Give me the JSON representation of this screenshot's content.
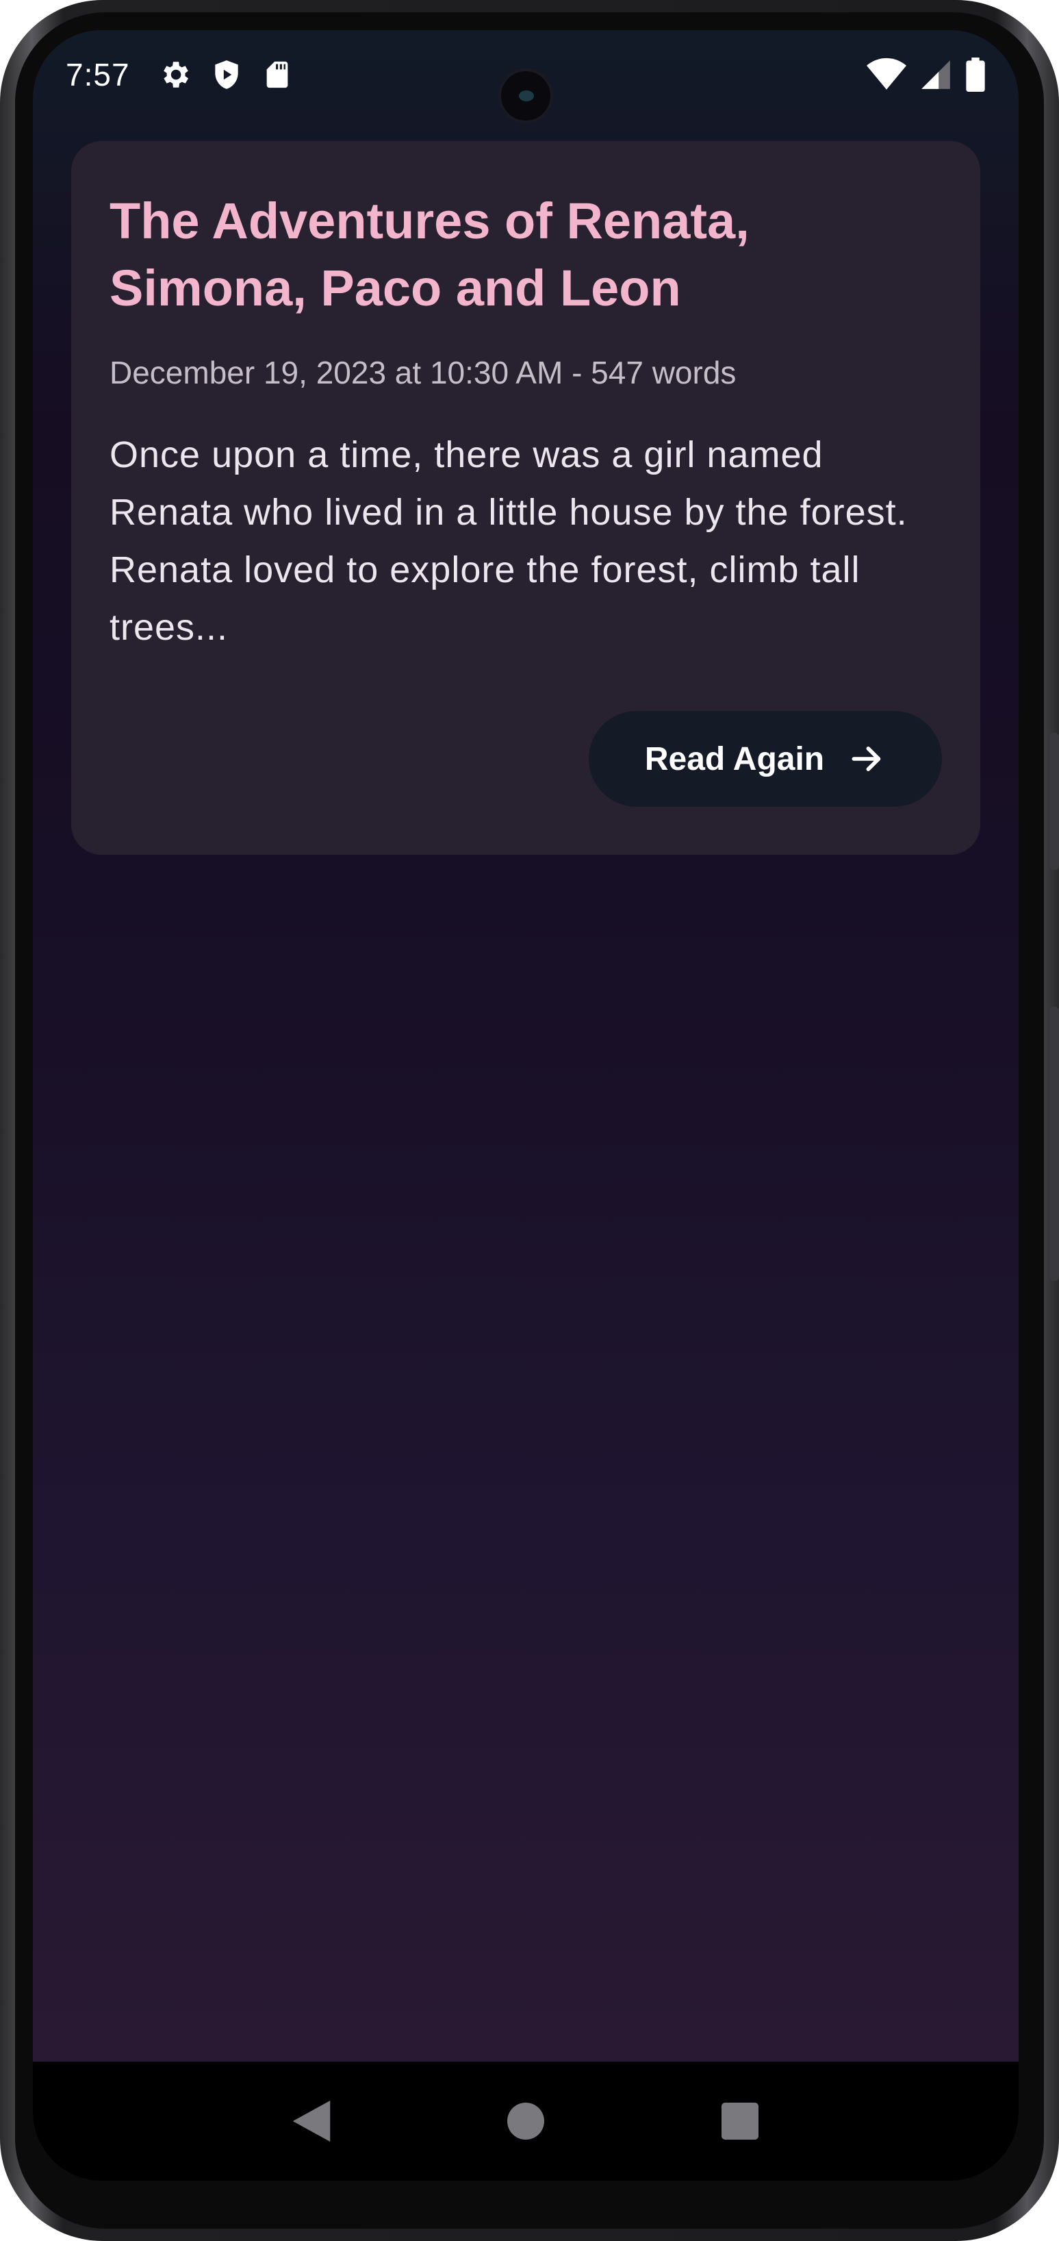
{
  "status_bar": {
    "time": "7:57",
    "left_icons": [
      "gear-icon",
      "shield-play-icon",
      "sd-card-icon"
    ],
    "right_icons": [
      "wifi-icon",
      "cellular-signal-icon",
      "battery-icon"
    ]
  },
  "story_card": {
    "title": "The Adventures of Renata, Simona, Paco and Leon",
    "meta": "December 19, 2023 at 10:30 AM - 547 words",
    "excerpt": "Once upon a time, there was a girl named Renata who lived in a little house by the forest. Renata loved to explore the forest, climb tall trees...",
    "button_label": "Read Again",
    "button_icon": "arrow-right-icon"
  },
  "nav_bar": {
    "buttons": [
      "back-triangle-icon",
      "home-circle-icon",
      "recents-square-icon"
    ]
  },
  "colors": {
    "title": "#f3b5cc",
    "card_background": "#28212f",
    "button_background": "#141b27"
  }
}
